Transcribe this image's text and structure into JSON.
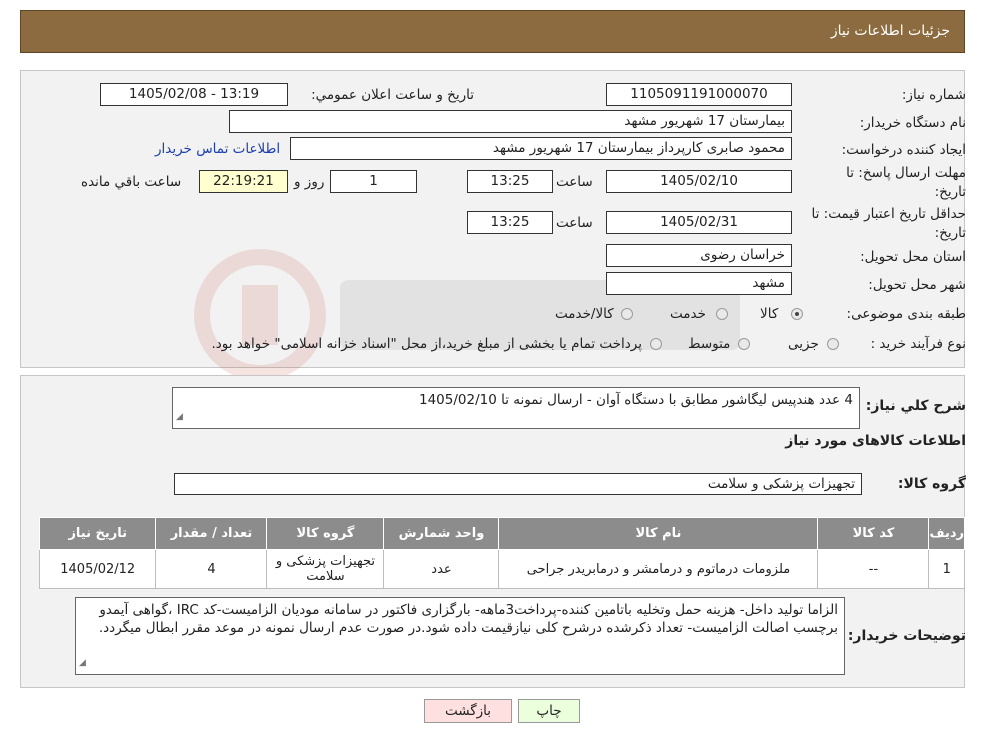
{
  "header": {
    "title": "جزئیات اطلاعات نیاز"
  },
  "details": {
    "need_number_label": "شماره نیاز:",
    "need_number": "1105091191000070",
    "announce_label": "تاريخ و ساعت اعلان عمومي:",
    "announce_value": "1405/02/08 - 13:19",
    "buyer_org_label": "نام دستگاه خریدار:",
    "buyer_org": "بیمارستان 17 شهریور مشهد",
    "creator_label": "ایجاد کننده درخواست:",
    "creator": "محمود صابری کارپرداز بیمارستان 17 شهریور مشهد",
    "contact_link": "اطلاعات تماس خریدار",
    "deadline_label_1": "مهلت ارسال پاسخ: تا",
    "deadline_label_2": "تاریخ:",
    "deadline_date": "1405/02/10",
    "time_label": "ساعت",
    "deadline_time": "13:25",
    "days_value": "1",
    "days_label": "روز و",
    "remaining_time": "22:19:21",
    "remaining_label": "ساعت باقي مانده",
    "validity_label_1": "حداقل تاریخ اعتبار قیمت: تا",
    "validity_label_2": "تاریخ:",
    "validity_date": "1405/02/31",
    "validity_time": "13:25",
    "province_label": "استان محل تحویل:",
    "province": "خراسان رضوی",
    "city_label": "شهر محل تحویل:",
    "city": "مشهد",
    "category_label": "طبقه بندی موضوعی:",
    "category_options": [
      "کالا",
      "خدمت",
      "کالا/خدمت"
    ],
    "category_selected": 0,
    "process_label": "نوع فرآیند خرید :",
    "process_options": [
      "جزیی",
      "متوسط"
    ],
    "process_note": "پرداخت تمام یا بخشی از مبلغ خرید،از محل \"اسناد خزانه اسلامی\" خواهد بود."
  },
  "need": {
    "summary_label": "شرح کلي نياز:",
    "summary": "4 عدد هندپیس لیگاشور مطابق با دستگاه آوان - ارسال نمونه تا 1405/02/10",
    "goods_info_title": "اطلاعات کالاهای مورد نیاز",
    "goods_group_label": "گروه کالا:",
    "goods_group": "تجهیزات پزشکی و سلامت"
  },
  "table": {
    "headers": [
      "ردیف",
      "کد کالا",
      "نام کالا",
      "واحد شمارش",
      "گروه کالا",
      "تعداد / مقدار",
      "تاریخ نیاز"
    ],
    "rows": [
      [
        "1",
        "--",
        "ملزومات درماتوم و درمامشر و درمابریدر جراحی",
        "عدد",
        "تجهیزات پزشکی و سلامت",
        "4",
        "1405/02/12"
      ]
    ]
  },
  "buyer_notes": {
    "label": "توضیحات خریدار:",
    "text": "الزاما تولید داخل- هزینه حمل وتخلیه باتامین کننده-پرداخت3ماهه- بارگزاری فاکتور در سامانه مودیان الزامیست-کد IRC ،گواهی آیمدو برچسب اصالت الزامیست- تعداد ذکرشده درشرح کلی نیازقیمت داده شود.در صورت عدم ارسال نمونه در موعد مقرر ابطال میگردد."
  },
  "buttons": {
    "print": "چاپ",
    "back": "بازگشت"
  },
  "colors": {
    "header_bg": "#8b6b3f",
    "print_bg": "#ecffdc",
    "back_bg": "#ffe0e0"
  }
}
